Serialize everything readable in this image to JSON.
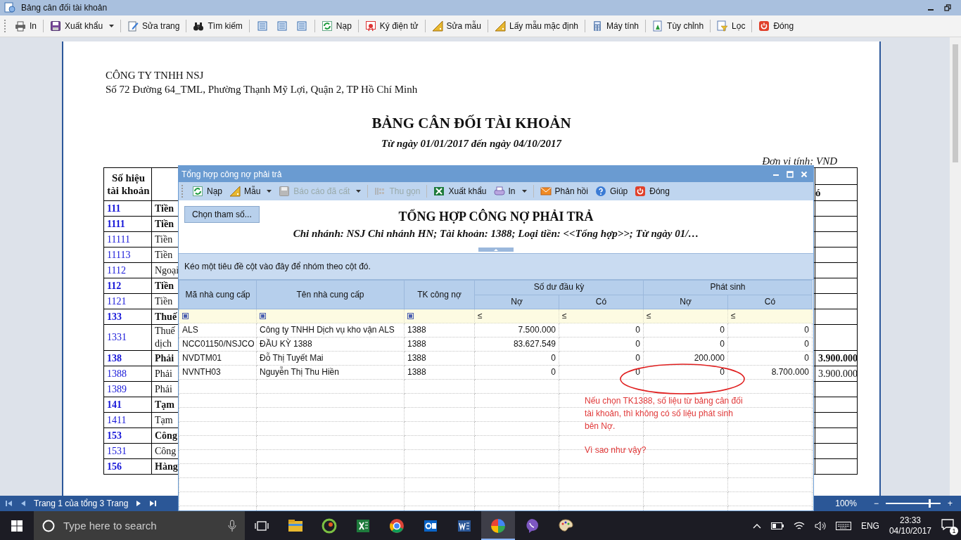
{
  "window": {
    "title": "Bảng cân đối tài khoản"
  },
  "toolbar": [
    {
      "label": "In",
      "dropdown": false
    },
    {
      "label": "Xuất khẩu",
      "dropdown": true
    },
    {
      "label": "Sửa trang",
      "dropdown": false
    },
    {
      "label": "Tìm kiếm",
      "dropdown": false
    },
    {
      "label": "Nạp",
      "dropdown": false
    },
    {
      "label": "Ký điện tử",
      "dropdown": false
    },
    {
      "label": "Sửa mẫu",
      "dropdown": false
    },
    {
      "label": "Lấy mẫu mặc định",
      "dropdown": false
    },
    {
      "label": "Máy tính",
      "dropdown": false
    },
    {
      "label": "Tùy chỉnh",
      "dropdown": false
    },
    {
      "label": "Lọc",
      "dropdown": false
    },
    {
      "label": "Đóng",
      "dropdown": false
    }
  ],
  "report": {
    "company": "CÔNG TY TNHH NSJ",
    "address": "Số 72 Đường 64_TML, Phường Thạnh Mỹ Lợi, Quận 2, TP Hồ Chí Minh",
    "title": "BẢNG CÂN ĐỐI TÀI KHOẢN",
    "period": "Từ ngày 01/01/2017 đến ngày 04/10/2017",
    "unit": "Đơn vị tính: VND",
    "table": {
      "header_account": "Số hiệu tài khoản",
      "header_column_3": "ó",
      "rows": [
        {
          "account": "111",
          "name": "Tiền",
          "bold": true
        },
        {
          "account": "1111",
          "name": "Tiền",
          "bold": true
        },
        {
          "account": "11111",
          "name": "Tiền",
          "bold": false
        },
        {
          "account": "11113",
          "name": "Tiền",
          "bold": false
        },
        {
          "account": "1112",
          "name": "Ngoại",
          "bold": false
        },
        {
          "account": "112",
          "name": "Tiền",
          "bold": true
        },
        {
          "account": "1121",
          "name": "Tiền",
          "bold": false
        },
        {
          "account": "133",
          "name": "Thuế",
          "bold": true
        },
        {
          "account": "1331",
          "name": "Thuế\ndịch",
          "bold": false
        },
        {
          "account": "138",
          "name": "Phải",
          "bold": true,
          "column_3": "3.900.000"
        },
        {
          "account": "1388",
          "name": "Phải",
          "bold": false,
          "column_3": "3.900.000"
        },
        {
          "account": "1389",
          "name": "Phải",
          "bold": false
        },
        {
          "account": "141",
          "name": "Tạm",
          "bold": true
        },
        {
          "account": "1411",
          "name": "Tạm",
          "bold": false
        },
        {
          "account": "153",
          "name": "Công",
          "bold": true
        },
        {
          "account": "1531",
          "name": "Công",
          "bold": false
        },
        {
          "account": "156",
          "name": "Hàng",
          "bold": true
        }
      ]
    }
  },
  "dialog": {
    "title": "Tổng hợp công nợ phải trả",
    "toolbar": [
      {
        "label": "Nạp",
        "dropdown": false,
        "disabled": false
      },
      {
        "label": "Mẫu",
        "dropdown": true,
        "disabled": false
      },
      {
        "label": "Báo cáo đã cất",
        "dropdown": true,
        "disabled": true
      },
      {
        "label": "Thu gọn",
        "dropdown": false,
        "disabled": true
      },
      {
        "label": "Xuất khẩu",
        "dropdown": false,
        "disabled": false
      },
      {
        "label": "In",
        "dropdown": true,
        "disabled": false
      },
      {
        "label": "Phản hồi",
        "dropdown": false,
        "disabled": false
      },
      {
        "label": "Giúp",
        "dropdown": false,
        "disabled": false
      },
      {
        "label": "Đóng",
        "dropdown": false,
        "disabled": false
      }
    ],
    "params_button": "Chọn tham số...",
    "report_title": "TỔNG HỢP CÔNG NỢ PHẢI TRẢ",
    "report_subtitle": "Chi nhánh: NSJ Chi nhánh HN; Tài khoản: 1388; Loại tiền: <<Tổng hợp>>; Từ ngày 01/…",
    "grid": {
      "group_hint": "Kéo một tiêu đề cột vào đây để nhóm theo cột đó.",
      "columns": [
        "Mã nhà cung cấp",
        "Tên nhà cung cấp",
        "TK công nợ"
      ],
      "column_groups": [
        {
          "label": "Số dư đầu kỳ",
          "sub": [
            "Nợ",
            "Có"
          ]
        },
        {
          "label": "Phát sinh",
          "sub": [
            "Nợ",
            "Có"
          ]
        }
      ],
      "filters": [
        {
          "kind": "box"
        },
        {
          "kind": "box"
        },
        {
          "kind": "box"
        },
        {
          "kind": "operator",
          "text": "≤"
        },
        {
          "kind": "operator",
          "text": "≤"
        },
        {
          "kind": "operator",
          "text": "≤"
        },
        {
          "kind": "operator",
          "text": "≤"
        }
      ],
      "rows": [
        [
          "ALS",
          "Công ty TNHH Dịch vụ kho vận ALS",
          "1388",
          "7.500.000",
          "0",
          "0",
          "0"
        ],
        [
          "NCC01150/NSJCO",
          "ĐẦU KỲ 1388",
          "1388",
          "83.627.549",
          "0",
          "0",
          "0"
        ],
        [
          "NVDTM01",
          "Đỗ Thị Tuyết Mai",
          "1388",
          "0",
          "0",
          "200.000",
          "0"
        ],
        [
          "NVNTH03",
          "Nguyễn Thị Thu Hiền",
          "1388",
          "0",
          "0",
          "0",
          "8.700.000"
        ]
      ]
    },
    "annotation": {
      "note": "Nếu chọn TK1388, số liệu từ bảng cân đối tài khoản, thì không có số liệu phát sinh bên Nợ.",
      "question": "Vì sao như vậy?"
    }
  },
  "status_bar": {
    "page": "Trang 1 của tổng 3 Trang",
    "zoom": "100%",
    "zoom_out": "−",
    "zoom_in": "+",
    "level": 0.8
  },
  "taskbar": {
    "search_placeholder": "Type here to search",
    "apps": [
      {
        "selected": false
      },
      {
        "selected": false
      },
      {
        "selected": false
      },
      {
        "selected": false
      },
      {
        "selected": false
      },
      {
        "selected": false
      },
      {
        "selected": true
      },
      {
        "selected": false
      },
      {
        "selected": false
      }
    ],
    "language": "ENG",
    "time": "23:33",
    "date": "04/10/2017",
    "notifications": "1"
  }
}
